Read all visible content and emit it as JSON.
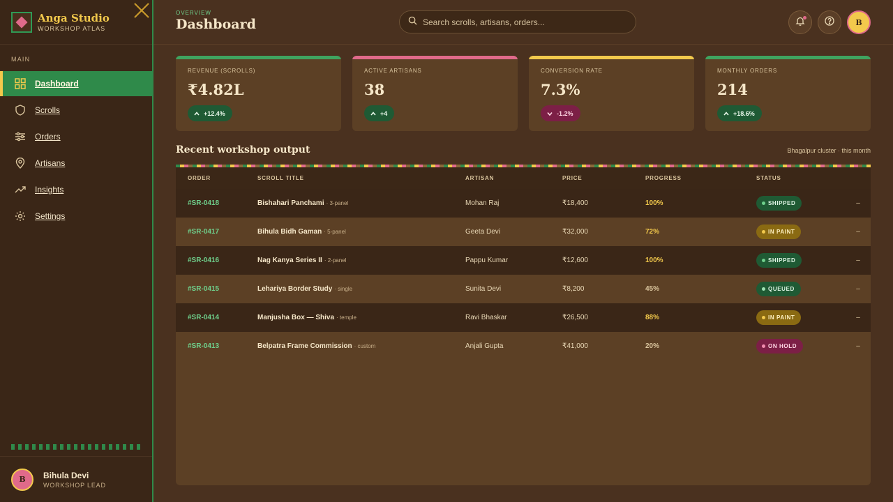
{
  "brand": {
    "name": "Anga Studio",
    "subtitle": "WORKSHOP ATLAS"
  },
  "sidebar": {
    "section_label": "MAIN",
    "items": [
      {
        "label": "Dashboard",
        "icon": "grid-icon"
      },
      {
        "label": "Scrolls",
        "icon": "shield-icon"
      },
      {
        "label": "Orders",
        "icon": "sliders-icon"
      },
      {
        "label": "Artisans",
        "icon": "location-pin-icon"
      },
      {
        "label": "Insights",
        "icon": "trending-up-icon"
      },
      {
        "label": "Settings",
        "icon": "gear-icon"
      }
    ],
    "active": "Dashboard",
    "user": {
      "initial": "B",
      "name": "Bihula Devi",
      "role": "WORKSHOP LEAD"
    }
  },
  "header": {
    "breadcrumb": "OVERVIEW",
    "title": "Dashboard",
    "search_placeholder": "Search scrolls, artisans, orders...",
    "avatar_initial": "B"
  },
  "kpis": [
    {
      "label": "REVENUE (SCROLLS)",
      "value": "₹4.82L",
      "delta": "+12.4%",
      "direction": "up",
      "accent": "#3fa35f"
    },
    {
      "label": "ACTIVE ARTISANS",
      "value": "38",
      "delta": "+4",
      "direction": "up",
      "accent": "#e06a8a"
    },
    {
      "label": "CONVERSION RATE",
      "value": "7.3%",
      "delta": "-1.2%",
      "direction": "down",
      "accent": "#f2c94c"
    },
    {
      "label": "MONTHLY ORDERS",
      "value": "214",
      "delta": "+18.6%",
      "direction": "up",
      "accent": "#3fa35f"
    }
  ],
  "table": {
    "title": "Recent workshop output",
    "meta": "Bhagalpur cluster · this month",
    "columns": [
      "ORDER",
      "SCROLL TITLE",
      "ARTISAN",
      "PRICE",
      "PROGRESS",
      "STATUS"
    ],
    "rows": [
      {
        "order": "#SR-0418",
        "title": "Bishahari Panchami",
        "sub": "· 3-panel",
        "artisan": "Mohan Raj",
        "price": "₹18,400",
        "progress": "100%",
        "status": "SHIPPED",
        "status_kind": "shipped",
        "more": "–"
      },
      {
        "order": "#SR-0417",
        "title": "Bihula Bidh Gaman",
        "sub": "· 5-panel",
        "artisan": "Geeta Devi",
        "price": "₹32,000",
        "progress": "72%",
        "status": "IN PAINT",
        "status_kind": "inpaint",
        "more": "–"
      },
      {
        "order": "#SR-0416",
        "title": "Nag Kanya Series II",
        "sub": "· 2-panel",
        "artisan": "Pappu Kumar",
        "price": "₹12,600",
        "progress": "100%",
        "status": "SHIPPED",
        "status_kind": "shipped",
        "more": "–"
      },
      {
        "order": "#SR-0415",
        "title": "Lehariya Border Study",
        "sub": "· single",
        "artisan": "Sunita Devi",
        "price": "₹8,200",
        "progress": "45%",
        "status": "QUEUED",
        "status_kind": "queued",
        "more": "–"
      },
      {
        "order": "#SR-0414",
        "title": "Manjusha Box — Shiva",
        "sub": "· temple",
        "artisan": "Ravi Bhaskar",
        "price": "₹26,500",
        "progress": "88%",
        "status": "IN PAINT",
        "status_kind": "inpaint",
        "more": "–"
      },
      {
        "order": "#SR-0413",
        "title": "Belpatra Frame Commission",
        "sub": "· custom",
        "artisan": "Anjali Gupta",
        "price": "₹41,000",
        "progress": "20%",
        "status": "ON HOLD",
        "status_kind": "onhold",
        "more": "–"
      }
    ]
  },
  "colors": {
    "primary_green": "#2f8a4a",
    "gold": "#f2c94c",
    "pink": "#e06a8a",
    "bg": "#4a311f",
    "sidebar_bg": "#3a2617"
  }
}
